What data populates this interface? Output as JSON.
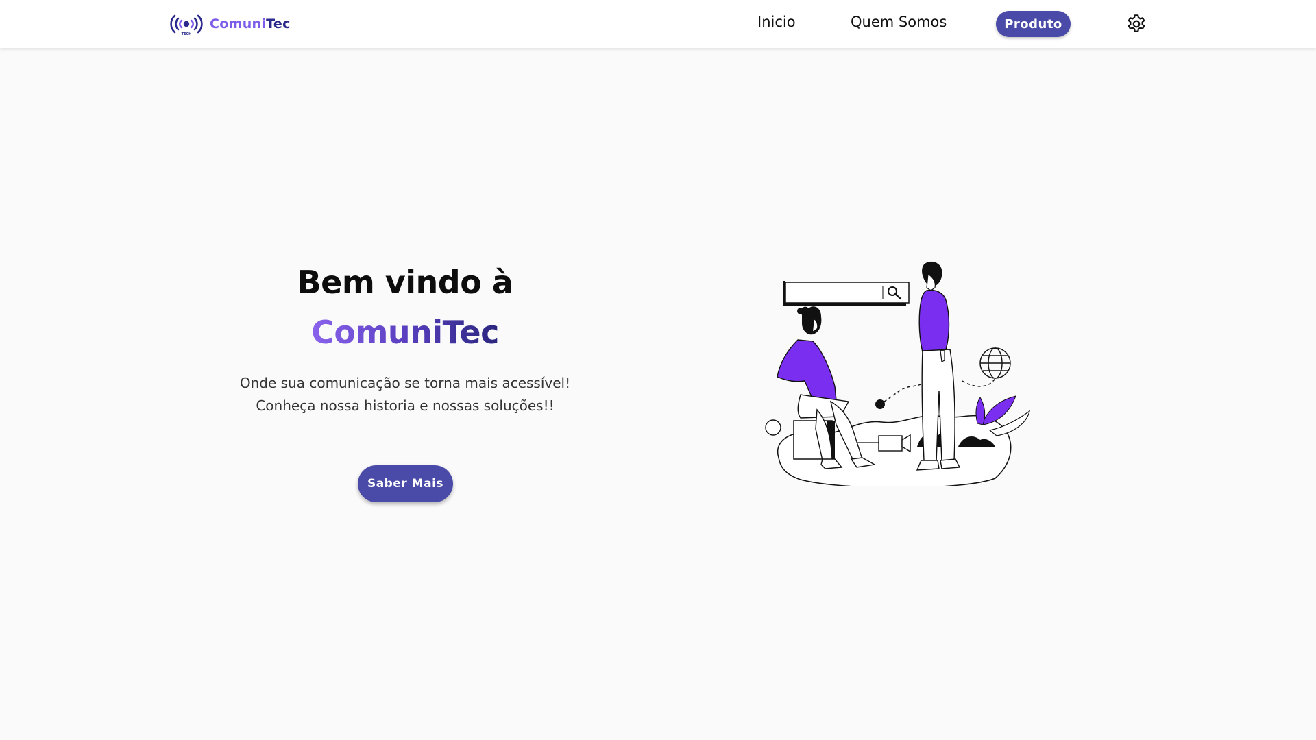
{
  "navbar": {
    "logo_icon": "broadcast-signal-icon",
    "logo_text_part1": "Comuni",
    "logo_text_part2": "Tec",
    "links": [
      {
        "label": "Inicio"
      },
      {
        "label": "Quem Somos"
      },
      {
        "label": "Produto",
        "active": true
      }
    ],
    "settings_icon": "gear-icon"
  },
  "hero": {
    "title": "Bem vindo à",
    "brand": "ComuniTec",
    "subtitle_line1": "Onde sua comunicação se torna mais acessível!",
    "subtitle_line2": "Conheça nossa historia e nossas soluções!!",
    "button_label": "Saber Mais",
    "illustration": "people-search-illustration"
  },
  "colors": {
    "primary": "#4a4aa8",
    "brand_light": "#8a63ec",
    "brand_dark": "#2a277e",
    "accent_purple": "#7a2ff0",
    "background": "#fafafa"
  }
}
